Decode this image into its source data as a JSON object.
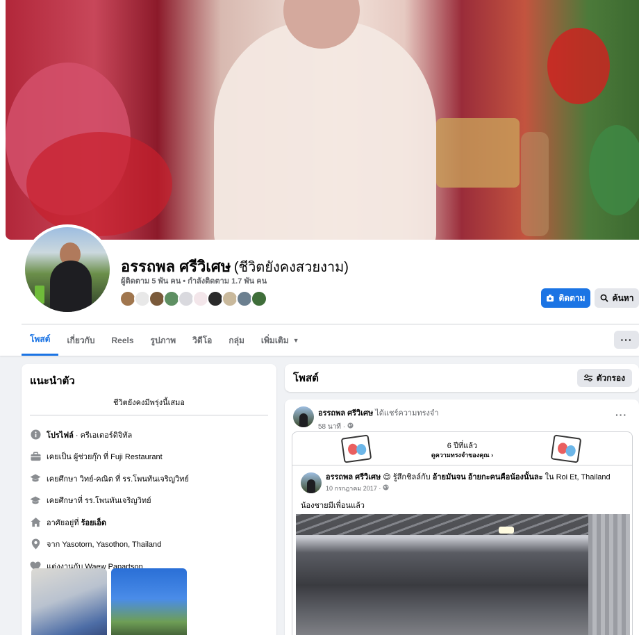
{
  "profile": {
    "name": "อรรถพล ศรีวิเศษ",
    "alternate_name": "(ชีวิตยังคงสวยงาม)",
    "stats": "ผู้ติดตาม 5 พัน คน • กำลังติดตาม 1.7 พัน คน",
    "follow_button": "ติดตาม",
    "search_button": "ค้นหา"
  },
  "tabs": [
    {
      "label": "โพสต์",
      "active": true
    },
    {
      "label": "เกี่ยวกับ"
    },
    {
      "label": "Reels"
    },
    {
      "label": "รูปภาพ"
    },
    {
      "label": "วิดีโอ"
    },
    {
      "label": "กลุ่ม"
    },
    {
      "label": "เพิ่มเติม"
    }
  ],
  "intro": {
    "title": "แนะนำตัว",
    "bio": "ชีวิตยังคงมีพรุ่งนี้เสมอ",
    "items": [
      {
        "icon": "info-icon",
        "prefix": "โปรไฟล์",
        "text": " · ครีเอเตอร์ดิจิทัล"
      },
      {
        "icon": "briefcase-icon",
        "prefix": "",
        "text": "เคยเป็น ผู้ช่วยกุ๊ก ที่ Fuji Restaurant"
      },
      {
        "icon": "graduation-cap-icon",
        "prefix": "",
        "text": "เคยศึกษา วิทย์-คณิต ที่ รร.โพนทันเจริญวิทย์"
      },
      {
        "icon": "graduation-cap-icon",
        "prefix": "",
        "text": "เคยศึกษาที่ รร.โพนทันเจริญวิทย์"
      },
      {
        "icon": "home-icon",
        "prefix": "",
        "text": "อาศัยอยู่ที่ ",
        "bold": "ร้อยเอ็ด"
      },
      {
        "icon": "location-pin-icon",
        "prefix": "",
        "text": "จาก Yasotorn, Yasothon, Thailand"
      },
      {
        "icon": "heart-icon",
        "prefix": "",
        "text": "แต่งงานกับ Waew Papartson"
      }
    ]
  },
  "posts_header": {
    "title": "โพสต์",
    "filter": "ตัวกรอง"
  },
  "post": {
    "author": "อรรถพล ศรีวิเศษ",
    "action": " ได้แชร์ความทรงจำ",
    "time": "58 นาที ·",
    "memory": {
      "years_ago": "6 ปีที่แล้ว",
      "link": "ดูความทรงจำของคุณ"
    },
    "original": {
      "author": "อรรถพล ศรีวิเศษ",
      "feeling": " 😌 รู้สึกชิลล์กับ ",
      "with": "อ้ายมันจน อ้ายกะคนคือน้องนั้นละ",
      "location_prefix": " ใน ",
      "location": "Roi Et, Thailand",
      "date": "10 กรกฎาคม 2017 ·",
      "text": "น้องชายมีเพื่อนแล้ว"
    }
  },
  "colors": {
    "accent": "#1b74e4",
    "page_bg": "#f0f2f5",
    "secondary_text": "#65676b"
  }
}
